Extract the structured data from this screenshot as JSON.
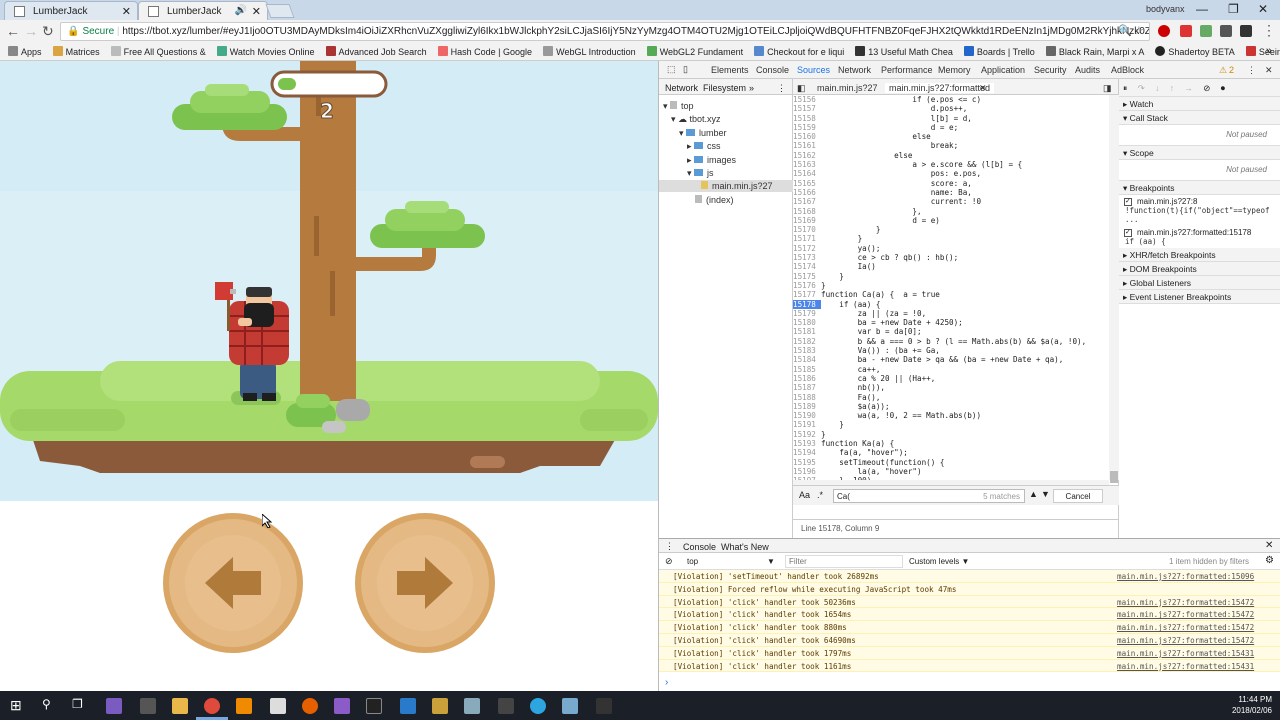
{
  "browser": {
    "tabs": [
      {
        "title": "LumberJack",
        "active": false
      },
      {
        "title": "LumberJack",
        "active": true
      }
    ],
    "profile_name": "bodyvanx",
    "window_controls": [
      "minimize",
      "restore",
      "close"
    ],
    "url_secure_label": "Secure",
    "url": "https://tbot.xyz/lumber/#eyJ1Ijo0OTU3MDAyMDksIm4iOiJiZXRhcnVuZXggliwiZyl6Ikx1bWJlckphY2siLCJjaSI6IjY5NzYyMzg4OTM4OTU2Mjg1OTEiLCJpljoiQWdBQUFHTFNBZ0FqeFJHX2tQWkktd1RDeENzIn1jMDg0M2RkYjhkNzk0ZTA1YThlYTI0...",
    "bookmarks": [
      "Apps",
      "Matrices",
      "Free All Questions &",
      "Watch Movies Online",
      "Advanced Job Search",
      "Hash Code | Google",
      "WebGL Introduction",
      "WebGL2 Fundament",
      "Checkout for e liqui",
      "13 Useful Math Chea",
      "Boards | Trello",
      "Black Rain, Marpi x A",
      "Shadertoy BETA",
      "Seeing Theory"
    ]
  },
  "game": {
    "score": "2",
    "timer_fraction": 0.18,
    "controls": {
      "left": "left-arrow",
      "right": "right-arrow"
    }
  },
  "devtools": {
    "main_tabs": [
      "Elements",
      "Console",
      "Sources",
      "Network",
      "Performance",
      "Memory",
      "Application",
      "Security",
      "Audits",
      "AdBlock"
    ],
    "active_tab": "Sources",
    "warning_count": "2",
    "navigator": {
      "subtabs": [
        "Network",
        "Filesystem"
      ],
      "tree": [
        {
          "label": "top",
          "depth": 0,
          "kind": "frame"
        },
        {
          "label": "tbot.xyz",
          "depth": 1,
          "kind": "cloud"
        },
        {
          "label": "lumber",
          "depth": 2,
          "kind": "folder"
        },
        {
          "label": "css",
          "depth": 3,
          "kind": "folder"
        },
        {
          "label": "images",
          "depth": 3,
          "kind": "folder"
        },
        {
          "label": "js",
          "depth": 3,
          "kind": "folder"
        },
        {
          "label": "main.min.js?27",
          "depth": 4,
          "kind": "file",
          "selected": true
        },
        {
          "label": "(index)",
          "depth": 3,
          "kind": "doc"
        }
      ]
    },
    "editor": {
      "tabs": [
        "main.min.js?27",
        "main.min.js?27:formatted"
      ],
      "lines": [
        {
          "n": "15156",
          "text": "                    if (e.pos <= c)"
        },
        {
          "n": "15157",
          "text": "                        d.pos++,"
        },
        {
          "n": "15158",
          "text": "                        l[b] = d,"
        },
        {
          "n": "15159",
          "text": "                        d = e;"
        },
        {
          "n": "15160",
          "text": "                    else"
        },
        {
          "n": "15161",
          "text": "                        break;"
        },
        {
          "n": "15162",
          "text": "                else"
        },
        {
          "n": "15163",
          "text": "                    a > e.score && (l[b] = {"
        },
        {
          "n": "15164",
          "text": "                        pos: e.pos,"
        },
        {
          "n": "15165",
          "text": "                        score: a,"
        },
        {
          "n": "15166",
          "text": "                        name: Ba,"
        },
        {
          "n": "15167",
          "text": "                        current: !0"
        },
        {
          "n": "15168",
          "text": "                    },"
        },
        {
          "n": "15169",
          "text": "                    d = e)"
        },
        {
          "n": "15170",
          "text": "            }"
        },
        {
          "n": "15171",
          "text": "        }"
        },
        {
          "n": "15172",
          "text": "        ya();"
        },
        {
          "n": "15173",
          "text": "        ce > cb ? qb() : hb();"
        },
        {
          "n": "15174",
          "text": "        Ia()"
        },
        {
          "n": "15175",
          "text": "    }"
        },
        {
          "n": "15176",
          "text": "}"
        },
        {
          "n": "15177",
          "text": "function Ca(a) {  a = true"
        },
        {
          "n": "15178",
          "text": "    if (aa) {",
          "breakpoint": true
        },
        {
          "n": "15179",
          "text": "        za || (za = !0,"
        },
        {
          "n": "15180",
          "text": "        ba = +new Date + 4250);"
        },
        {
          "n": "15181",
          "text": "        var b = da[0];"
        },
        {
          "n": "15182",
          "text": "        b && a === 0 > b ? (l == Math.abs(b) && $a(a, !0),"
        },
        {
          "n": "15183",
          "text": "        Va()) : (ba += Ga,"
        },
        {
          "n": "15184",
          "text": "        ba - +new Date > qa && (ba = +new Date + qa),"
        },
        {
          "n": "15185",
          "text": "        ca++,"
        },
        {
          "n": "15186",
          "text": "        ca % 20 || (Ha++,"
        },
        {
          "n": "15187",
          "text": "        nb()),"
        },
        {
          "n": "15188",
          "text": "        Fa(),"
        },
        {
          "n": "15189",
          "text": "        $a(a));"
        },
        {
          "n": "15190",
          "text": "        wa(a, !0, 2 == Math.abs(b))"
        },
        {
          "n": "15191",
          "text": "    }"
        },
        {
          "n": "15192",
          "text": "}"
        },
        {
          "n": "15193",
          "text": "function Ka(a) {"
        },
        {
          "n": "15194",
          "text": "    fa(a, \"hover\");"
        },
        {
          "n": "15195",
          "text": "    setTimeout(function() {"
        },
        {
          "n": "15196",
          "text": "        la(a, \"hover\")"
        },
        {
          "n": "15197",
          "text": "    }, 100)"
        },
        {
          "n": "15198",
          "text": ""
        }
      ],
      "find_label": "Aa",
      "find_regex": ".*",
      "find_query": "Ca(",
      "find_count": "5 matches",
      "cancel_label": "Cancel",
      "status": "Line 15178, Column 9"
    },
    "sidebar": {
      "watch": "Watch",
      "call_stack": "Call Stack",
      "not_paused": "Not paused",
      "scope": "Scope",
      "breakpoints_title": "Breakpoints",
      "breakpoints": [
        {
          "file": "main.min.js?27:8",
          "code": "!function(t){if(\"object\"==typeof ..."
        },
        {
          "file": "main.min.js?27:formatted:15178",
          "code": "if (aa) {"
        }
      ],
      "sections": [
        "XHR/fetch Breakpoints",
        "DOM Breakpoints",
        "Global Listeners",
        "Event Listener Breakpoints"
      ]
    },
    "console": {
      "tabs": [
        "Console",
        "What's New"
      ],
      "context": "top",
      "filter_placeholder": "Filter",
      "levels": "Custom levels ▼",
      "hidden": "1 item hidden by filters",
      "messages": [
        {
          "text": "[Violation] 'setTimeout' handler took 26892ms",
          "src": "main.min.js?27:formatted:15096"
        },
        {
          "text": "[Violation] Forced reflow while executing JavaScript took 47ms",
          "src": ""
        },
        {
          "text": "[Violation] 'click' handler took 50236ms",
          "src": "main.min.js?27:formatted:15472"
        },
        {
          "text": "[Violation] 'click' handler took 1654ms",
          "src": "main.min.js?27:formatted:15472"
        },
        {
          "text": "[Violation] 'click' handler took 880ms",
          "src": "main.min.js?27:formatted:15472"
        },
        {
          "text": "[Violation] 'click' handler took 64690ms",
          "src": "main.min.js?27:formatted:15472"
        },
        {
          "text": "[Violation] 'click' handler took 1797ms",
          "src": "main.min.js?27:formatted:15431"
        },
        {
          "text": "[Violation] 'click' handler took 1161ms",
          "src": "main.min.js?27:formatted:15431"
        }
      ],
      "prompt": "›"
    }
  },
  "taskbar": {
    "time": "11:44 PM",
    "date": "2018/02/06"
  },
  "colors": {
    "sky": "#d3ecf5",
    "grass": "#a5d96a",
    "trunk": "#b57a3e",
    "shirt": "#c43b33",
    "devtools_accent": "#1a73e8",
    "violation_bg": "#fffbe5"
  }
}
